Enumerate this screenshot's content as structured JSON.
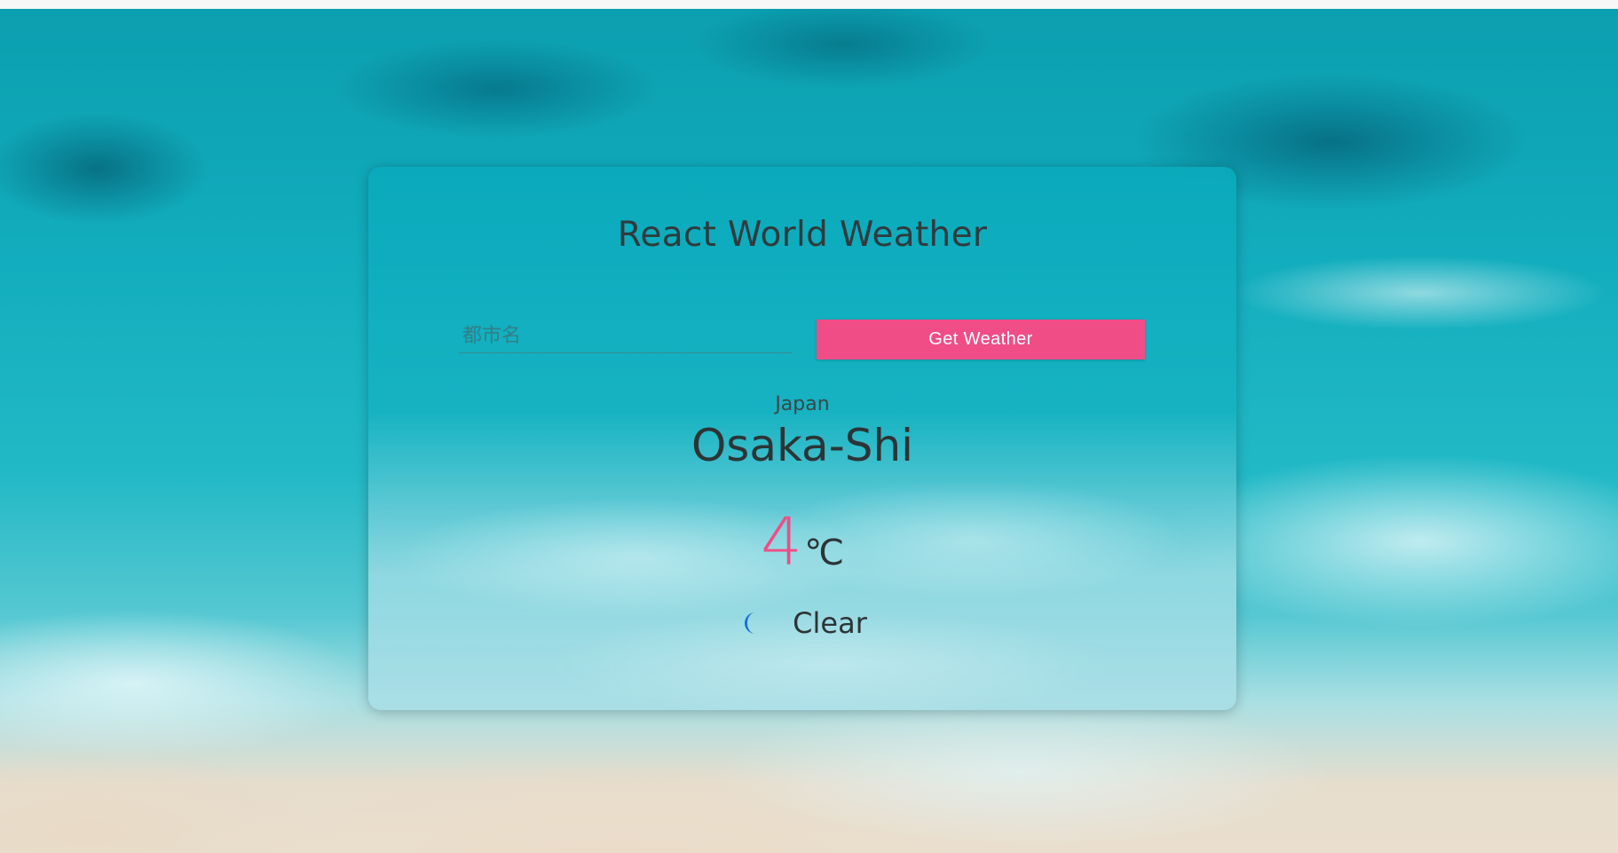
{
  "app": {
    "title": "React World Weather"
  },
  "search": {
    "placeholder": "都市名",
    "value": "",
    "button_label": "Get Weather"
  },
  "weather": {
    "country": "Japan",
    "city": "Osaka-Shi",
    "temperature": "4",
    "unit": "℃",
    "condition": "Clear",
    "condition_icon": "moon-icon"
  },
  "colors": {
    "accent": "#f04d86",
    "icon": "#1a6fd6",
    "text": "#2c3436"
  }
}
